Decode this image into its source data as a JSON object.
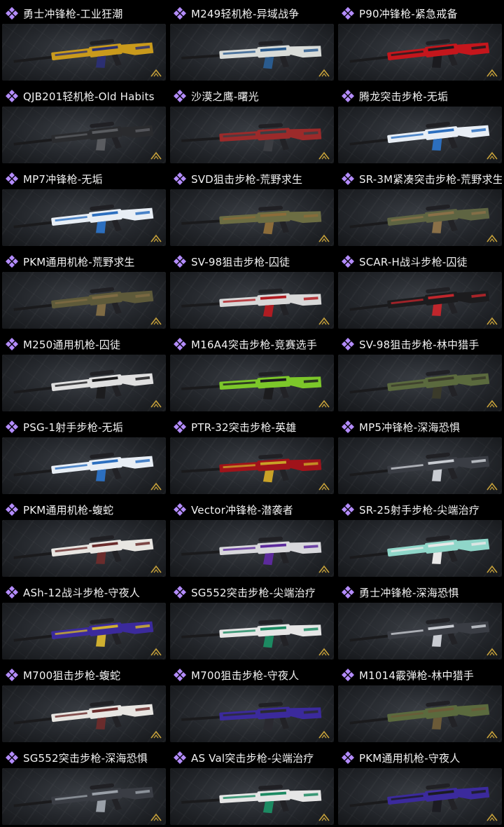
{
  "colors": {
    "background": "#000000",
    "rarity_purple": "#b48cff",
    "title_text": "#f2f2f2",
    "card_bg": "#24272c"
  },
  "icons": {
    "rarity": "purple-diamond-cluster-icon",
    "corner": "gold-chevron-icon"
  },
  "items": [
    {
      "title": "勇士冲锋枪-工业狂潮",
      "skin": [
        "#c99a1c",
        "#2b2f72"
      ]
    },
    {
      "title": "M249轻机枪-异域战争",
      "skin": [
        "#d9dcd9",
        "#2a5b8e"
      ]
    },
    {
      "title": "P90冲锋枪-紧急戒备",
      "skin": [
        "#c4161c",
        "#1b1b1f"
      ]
    },
    {
      "title": "QJB201轻机枪-Old Habits",
      "skin": [
        "#2a2b2e",
        "#5a5c60"
      ]
    },
    {
      "title": "沙漠之鹰-曙光",
      "skin": [
        "#9b2a2a",
        "#3b3d42"
      ]
    },
    {
      "title": "腾龙突击步枪-无垢",
      "skin": [
        "#e8eef5",
        "#2c6fbf"
      ]
    },
    {
      "title": "MP7冲锋枪-无垢",
      "skin": [
        "#e8eef5",
        "#2c6fbf"
      ]
    },
    {
      "title": "SVD狙击步枪-荒野求生",
      "skin": [
        "#6c6d43",
        "#8c6c3a"
      ]
    },
    {
      "title": "SR-3M紧凑突击步枪-荒野求生",
      "skin": [
        "#5e6442",
        "#8a7048"
      ]
    },
    {
      "title": "PKM通用机枪-荒野求生",
      "skin": [
        "#5e5a3a",
        "#7f6b44"
      ]
    },
    {
      "title": "SV-98狙击步枪-囚徒",
      "skin": [
        "#d8d8d8",
        "#b01c22"
      ]
    },
    {
      "title": "SCAR-H战斗步枪-囚徒",
      "skin": [
        "#1c1c1e",
        "#c0262c"
      ]
    },
    {
      "title": "M250通用机枪-囚徒",
      "skin": [
        "#e0e0e0",
        "#1c1c1e"
      ]
    },
    {
      "title": "M16A4突击步枪-竞赛选手",
      "skin": [
        "#7cc72a",
        "#1c1c1e"
      ]
    },
    {
      "title": "SV-98狙击步枪-林中猎手",
      "skin": [
        "#5b6a3e",
        "#3a3a2a"
      ]
    },
    {
      "title": "PSG-1射手步枪-无垢",
      "skin": [
        "#e8eef5",
        "#2c6fbf"
      ]
    },
    {
      "title": "PTR-32突击步枪-英雄",
      "skin": [
        "#a0131a",
        "#c9a227"
      ]
    },
    {
      "title": "MP5冲锋枪-深海恐惧",
      "skin": [
        "#3a3d44",
        "#c9ccd2"
      ]
    },
    {
      "title": "PKM通用机枪-蝮蛇",
      "skin": [
        "#e8e6e2",
        "#6a2c2c"
      ]
    },
    {
      "title": "Vector冲锋枪-潜袭者",
      "skin": [
        "#d8d8dc",
        "#5c2a9c"
      ]
    },
    {
      "title": "SR-25射手步枪-尖端治疗",
      "skin": [
        "#8fd6c9",
        "#e8e8e8"
      ]
    },
    {
      "title": "ASh-12战斗步枪-守夜人",
      "skin": [
        "#3b2a9c",
        "#d0b030"
      ]
    },
    {
      "title": "SG552突击步枪-尖端治疗",
      "skin": [
        "#e6e6e6",
        "#1c8a62"
      ]
    },
    {
      "title": "勇士冲锋枪-深海恐惧",
      "skin": [
        "#3a3d44",
        "#c9ccd2"
      ]
    },
    {
      "title": "M700狙击步枪-蝮蛇",
      "skin": [
        "#e8e6e2",
        "#6a2c2c"
      ]
    },
    {
      "title": "M700狙击步枪-守夜人",
      "skin": [
        "#3b2a9c",
        "#2a2a30"
      ]
    },
    {
      "title": "M1014霰弹枪-林中猎手",
      "skin": [
        "#5b6a3e",
        "#6b5a38"
      ]
    },
    {
      "title": "SG552突击步枪-深海恐惧",
      "skin": [
        "#3a3d44",
        "#9aa0a8"
      ]
    },
    {
      "title": "AS Val突击步枪-尖端治疗",
      "skin": [
        "#e6e6e6",
        "#1c8a62"
      ]
    },
    {
      "title": "PKM通用机枪-守夜人",
      "skin": [
        "#3b2a9c",
        "#1c1c22"
      ]
    }
  ]
}
